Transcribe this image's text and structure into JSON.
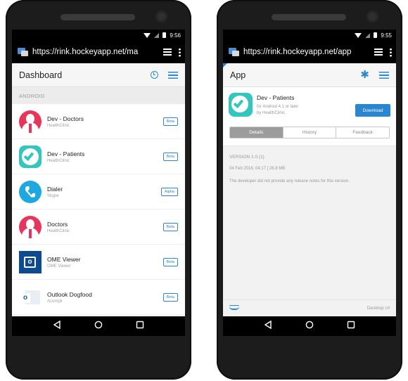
{
  "left_phone": {
    "status": {
      "time": "9:56"
    },
    "browser": {
      "url": "https://rink.hockeyapp.net/ma"
    },
    "appbar": {
      "title": "Dashboard"
    },
    "section": "ANDROID",
    "apps": [
      {
        "name": "Dev - Doctors",
        "publisher": "HealthClinic",
        "badge": "Beta",
        "icon": "doctor-icon"
      },
      {
        "name": "Dev - Patients",
        "publisher": "HealthClinic",
        "badge": "Beta",
        "icon": "patients-check-icon"
      },
      {
        "name": "Dialer",
        "publisher": "Skype",
        "badge": "Alpha",
        "icon": "phone-handset-icon"
      },
      {
        "name": "Doctors",
        "publisher": "HealthClinic",
        "badge": "Beta",
        "icon": "doctor-icon"
      },
      {
        "name": "OME Viewer",
        "publisher": "OME Viewer",
        "badge": "Beta",
        "icon": "outlook-o-icon"
      },
      {
        "name": "Outlook Dogfood",
        "publisher": "Acompli",
        "badge": "Beta",
        "icon": "outlook-envelope-icon"
      }
    ]
  },
  "right_phone": {
    "status": {
      "time": "9:55"
    },
    "browser": {
      "url": "https://rink.hockeyapp.net/app"
    },
    "appbar": {
      "title": "App"
    },
    "app": {
      "name": "Dev - Patients",
      "platform": "for Android 4.1 or later",
      "publisher": "by HealthClinic",
      "download_label": "Download"
    },
    "tabs": [
      {
        "label": "Details",
        "active": true
      },
      {
        "label": "History",
        "active": false
      },
      {
        "label": "Feedback",
        "active": false
      }
    ],
    "release": {
      "version": "VERSION 1.0 (1)",
      "date_size": "04 Feb 2016, 04:17 | 28.8 MB",
      "notes": "The developer did not provide any release notes for this version."
    },
    "footer": {
      "desktop_label": "Desktop UI"
    }
  },
  "colors": {
    "accent": "#2a86d1",
    "doctor": "#e8355a",
    "patients": "#33c6be",
    "dialer": "#1ea7e0",
    "ome": "#0c4a92"
  }
}
